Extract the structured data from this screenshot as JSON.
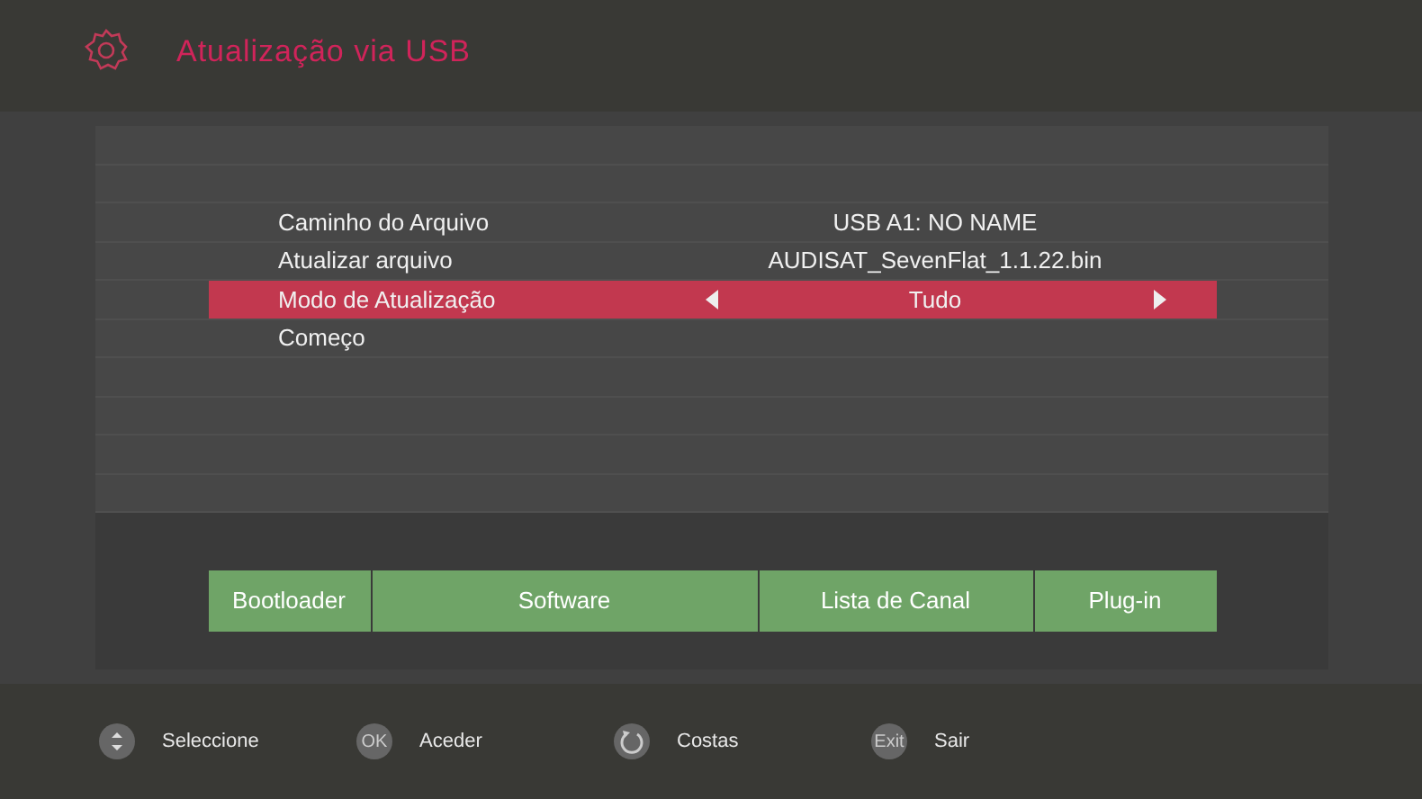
{
  "header": {
    "title": "Atualização via USB"
  },
  "rows": [
    {
      "kind": "value",
      "label": "Caminho do Arquivo",
      "value": "USB A1: NO NAME",
      "selected": false
    },
    {
      "kind": "value",
      "label": "Atualizar arquivo",
      "value": "AUDISAT_SevenFlat_1.1.22.bin",
      "selected": false
    },
    {
      "kind": "select",
      "label": "Modo de Atualização",
      "value": "Tudo",
      "selected": true
    },
    {
      "kind": "action",
      "label": "Começo",
      "selected": false
    }
  ],
  "buttons": [
    "Bootloader",
    "Software",
    "Lista de Canal",
    "Plug-in"
  ],
  "hints": [
    {
      "kind": "updown",
      "label": "Seleccione"
    },
    {
      "kind": "ok",
      "key": "OK",
      "label": "Aceder"
    },
    {
      "kind": "back",
      "label": "Costas"
    },
    {
      "kind": "exit",
      "key": "Exit",
      "label": "Sair"
    }
  ]
}
